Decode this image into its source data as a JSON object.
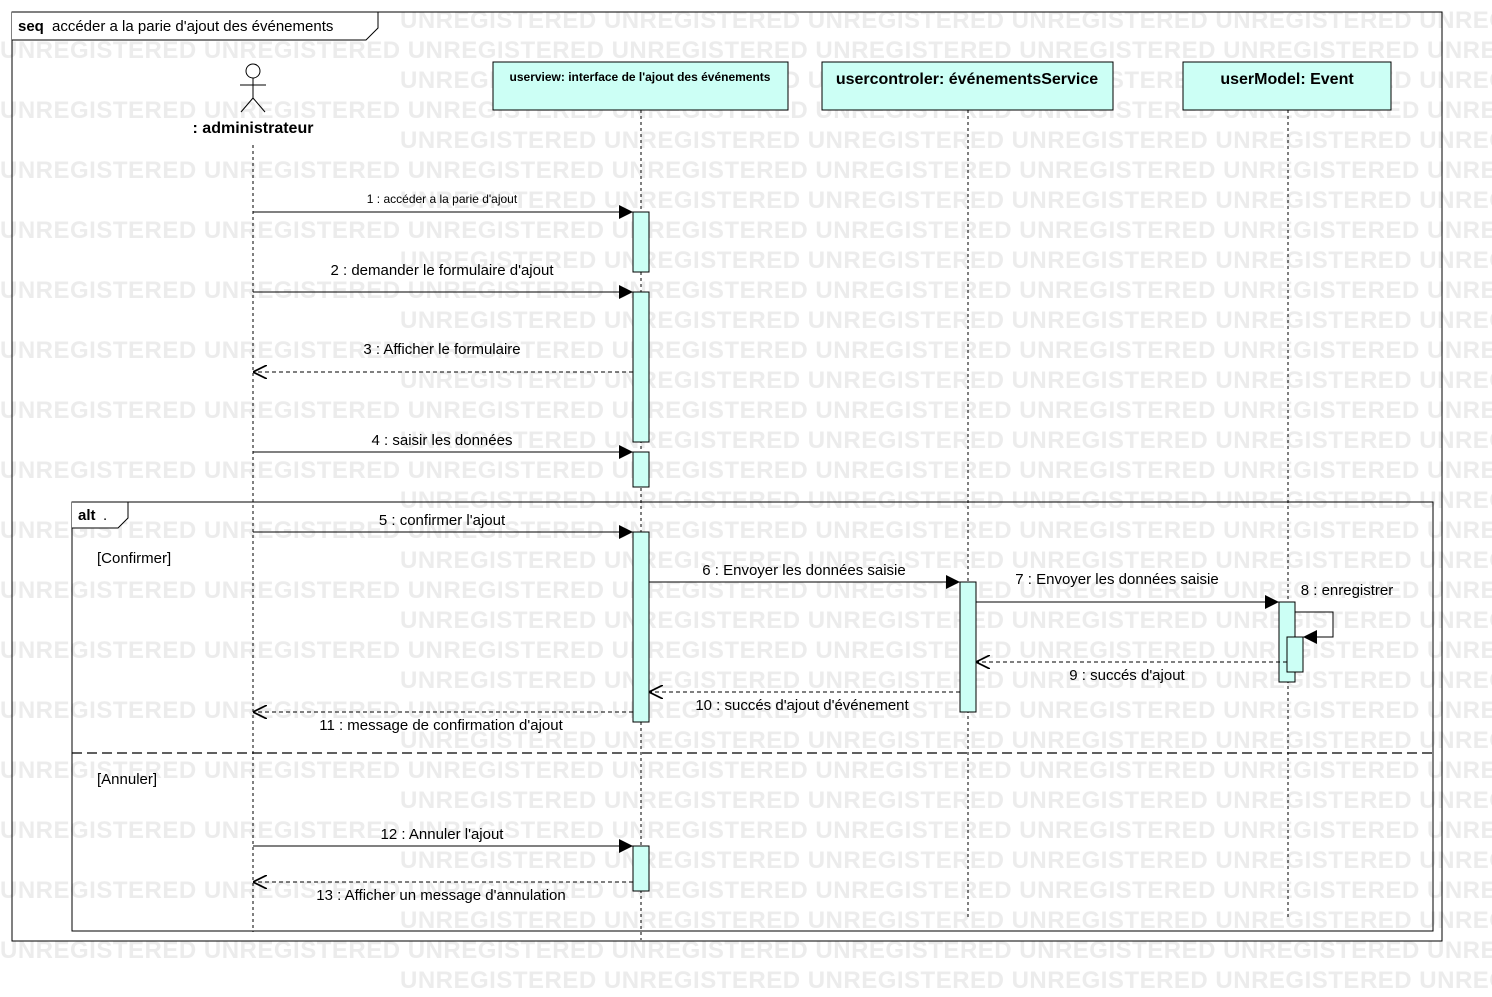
{
  "frame": {
    "keyword": "seq",
    "name": "accéder a la parie d'ajout des événements"
  },
  "watermark": "UNREGISTERED",
  "lifelines": [
    {
      "id": "admin",
      "label": ": administrateur",
      "kind": "actor"
    },
    {
      "id": "view",
      "label": "userview: interface de l'ajout des événements",
      "kind": "object"
    },
    {
      "id": "ctrl",
      "label": "usercontroler: événementsService",
      "kind": "object"
    },
    {
      "id": "model",
      "label": "userModel: Event",
      "kind": "object"
    }
  ],
  "messages": [
    {
      "id": "m1",
      "label": "1 : accéder a la parie d'ajout",
      "type": "sync"
    },
    {
      "id": "m2",
      "label": "2 : demander le formulaire d'ajout",
      "type": "sync"
    },
    {
      "id": "m3",
      "label": "3 : Afficher le formulaire",
      "type": "reply"
    },
    {
      "id": "m4",
      "label": "4 : saisir les données",
      "type": "sync"
    },
    {
      "id": "m5",
      "label": "5 : confirmer l'ajout",
      "type": "sync"
    },
    {
      "id": "m6",
      "label": "6 : Envoyer les données saisie",
      "type": "sync"
    },
    {
      "id": "m7",
      "label": "7 : Envoyer les données saisie",
      "type": "sync"
    },
    {
      "id": "m8",
      "label": "8 : enregistrer",
      "type": "self"
    },
    {
      "id": "m9",
      "label": "9 : succés d'ajout",
      "type": "reply"
    },
    {
      "id": "m10",
      "label": "10 : succés d'ajout  d'événement",
      "type": "reply"
    },
    {
      "id": "m11",
      "label": "11 : message de confirmation d'ajout",
      "type": "reply"
    },
    {
      "id": "m12",
      "label": "12 : Annuler l'ajout",
      "type": "sync"
    },
    {
      "id": "m13",
      "label": "13 : Afficher un message d'annulation",
      "type": "reply"
    }
  ],
  "fragment": {
    "operator": "alt",
    "name": ".",
    "guards": [
      "[Confirmer]",
      "[Annuler]"
    ]
  },
  "colors": {
    "lifeline_head_fill": "#ccfff5",
    "activation_fill": "#ccfff5",
    "line": "#000000",
    "watermark": "#ececec"
  }
}
